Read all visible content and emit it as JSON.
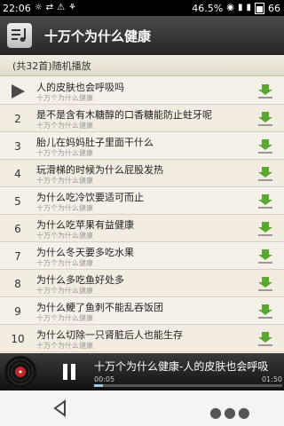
{
  "status": {
    "time": "22:06",
    "battery_pct": "46.5%",
    "signal_right": "66"
  },
  "header": {
    "title": "十万个为什么健康",
    "menu_icon": "music-list-icon"
  },
  "list_header": "(共32首)随机播放",
  "songs": [
    {
      "num": "",
      "title": "人的皮肤也会呼吸吗",
      "subtitle": "十万个为什么健康",
      "playing": true
    },
    {
      "num": "2",
      "title": "是不是含有木糖醇的口香糖能防止蛀牙呢",
      "subtitle": "十万个为什么健康"
    },
    {
      "num": "3",
      "title": "胎儿在妈妈肚子里面干什么",
      "subtitle": "十万个为什么健康"
    },
    {
      "num": "4",
      "title": "玩滑梯的时候为什么屁股发热",
      "subtitle": "十万个为什么健康"
    },
    {
      "num": "5",
      "title": "为什么吃冷饮要适可而止",
      "subtitle": "十万个为什么健康"
    },
    {
      "num": "6",
      "title": "为什么吃苹果有益健康",
      "subtitle": "十万个为什么健康"
    },
    {
      "num": "7",
      "title": "为什么冬天要多吃水果",
      "subtitle": "十万个为什么健康"
    },
    {
      "num": "8",
      "title": "为什么多吃鱼好处多",
      "subtitle": "十万个为什么健康"
    },
    {
      "num": "9",
      "title": "为什么鲠了鱼刺不能乱吞饭团",
      "subtitle": "十万个为什么健康"
    },
    {
      "num": "10",
      "title": "为什么切除一只肾脏后人也能生存",
      "subtitle": "十万个为什么健康"
    }
  ],
  "player": {
    "now_playing": "十万个为什么健康-人的皮肤也会呼吸",
    "current_time": "00:05",
    "total_time": "01:50",
    "progress_fraction": 0.045
  },
  "colors": {
    "download_green": "#5aa832",
    "progress": "#9ecbe6"
  }
}
